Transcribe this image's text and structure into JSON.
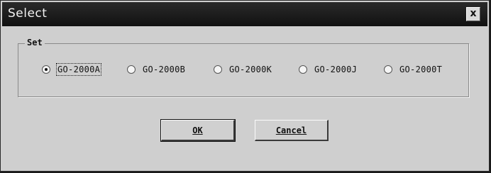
{
  "window": {
    "title": "Select",
    "close_label": "x"
  },
  "group": {
    "legend": "Set",
    "options": [
      {
        "label": "GO-2000A",
        "checked": true
      },
      {
        "label": "GO-2000B",
        "checked": false
      },
      {
        "label": "GO-2000K",
        "checked": false
      },
      {
        "label": "GO-2000J",
        "checked": false
      },
      {
        "label": "GO-2000T",
        "checked": false
      }
    ]
  },
  "buttons": {
    "ok_label": "OK",
    "cancel_label": "Cancel"
  }
}
